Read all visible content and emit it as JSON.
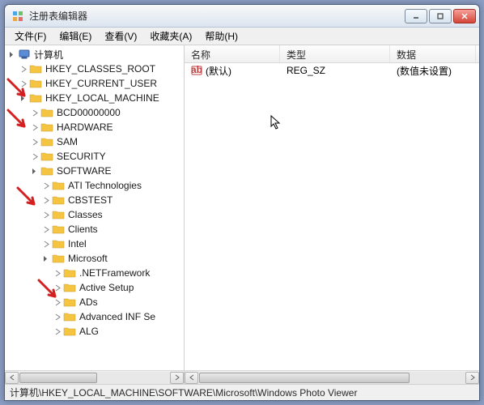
{
  "window": {
    "title": "注册表编辑器"
  },
  "menu": {
    "file": "文件(F)",
    "edit": "编辑(E)",
    "view": "查看(V)",
    "favorites": "收藏夹(A)",
    "help": "帮助(H)"
  },
  "tree": {
    "root": "计算机",
    "hkcr": "HKEY_CLASSES_ROOT",
    "hkcu": "HKEY_CURRENT_USER",
    "hklm": "HKEY_LOCAL_MACHINE",
    "bcd": "BCD00000000",
    "hardware": "HARDWARE",
    "sam": "SAM",
    "security": "SECURITY",
    "software": "SOFTWARE",
    "ati": "ATI Technologies",
    "cbstest": "CBSTEST",
    "classes": "Classes",
    "clients": "Clients",
    "intel": "Intel",
    "microsoft": "Microsoft",
    "netfw": ".NETFramework",
    "activesetup": "Active Setup",
    "ads": "ADs",
    "advinf": "Advanced INF Se",
    "alg": "ALG"
  },
  "columns": {
    "name": "名称",
    "type": "类型",
    "data": "数据",
    "name_w": 118,
    "type_w": 136,
    "data_w": 106
  },
  "values": {
    "default_name": "(默认)",
    "default_type": "REG_SZ",
    "default_data": "(数值未设置)"
  },
  "statusbar": {
    "path": "计算机\\HKEY_LOCAL_MACHINE\\SOFTWARE\\Microsoft\\Windows Photo Viewer"
  }
}
